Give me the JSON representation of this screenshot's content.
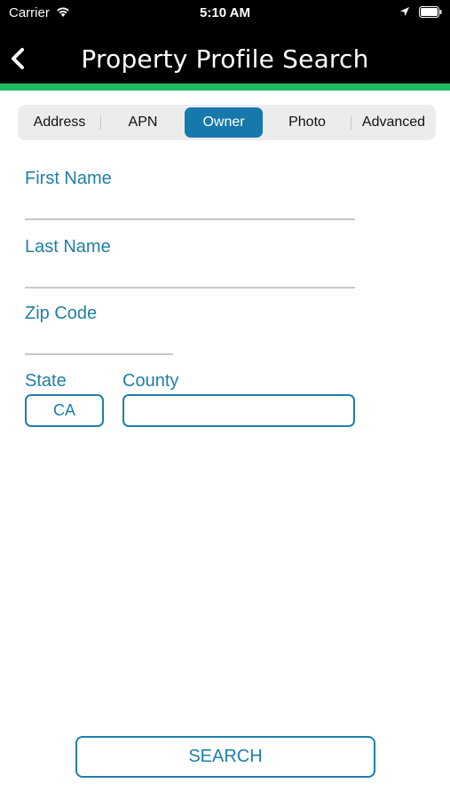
{
  "status_bar": {
    "carrier": "Carrier",
    "time": "5:10 AM"
  },
  "header": {
    "title": "Property Profile Search",
    "accent_color": "#1dbb63"
  },
  "tabs": [
    {
      "label": "Address",
      "active": false
    },
    {
      "label": "APN",
      "active": false
    },
    {
      "label": "Owner",
      "active": true
    },
    {
      "label": "Photo",
      "active": false
    },
    {
      "label": "Advanced",
      "active": false
    }
  ],
  "form": {
    "first_name": {
      "label": "First Name",
      "value": ""
    },
    "last_name": {
      "label": "Last Name",
      "value": ""
    },
    "zip_code": {
      "label": "Zip Code",
      "value": ""
    },
    "state": {
      "label": "State",
      "value": "CA"
    },
    "county": {
      "label": "County",
      "value": ""
    }
  },
  "search_button": {
    "label": "SEARCH"
  },
  "colors": {
    "primary": "#1e7fa6",
    "active_tab": "#1778ac",
    "header_bg": "#000000"
  }
}
